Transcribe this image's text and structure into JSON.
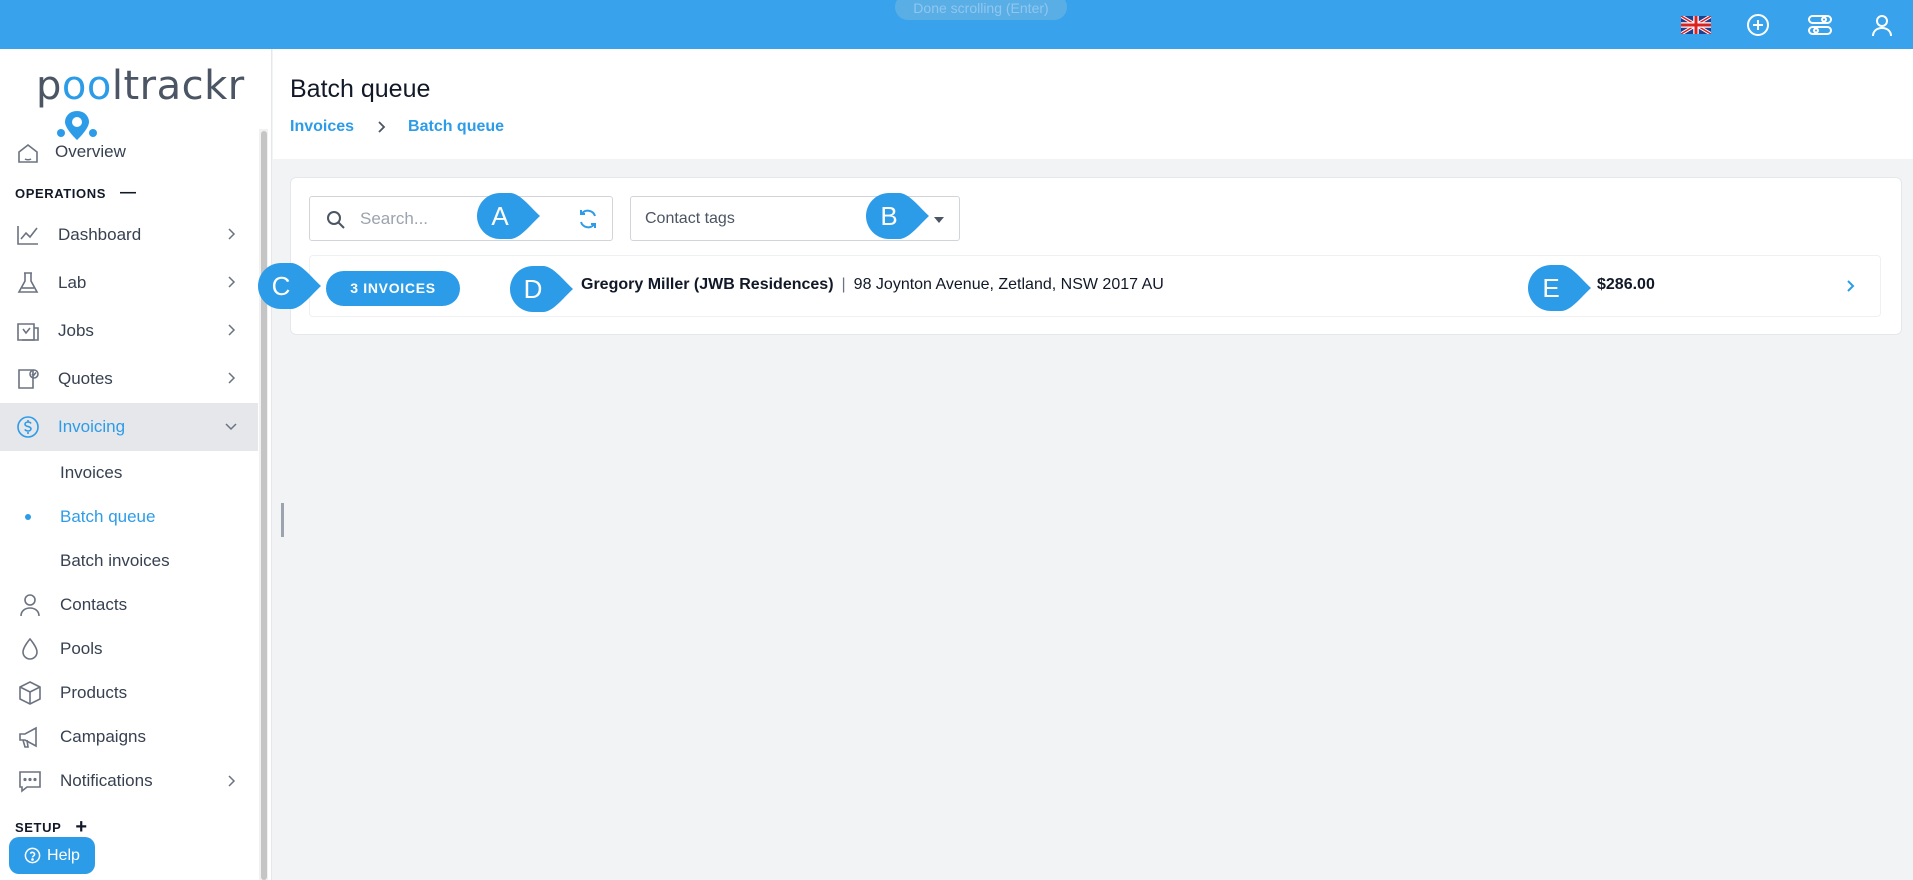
{
  "topbar": {
    "done_scrolling": "Done scrolling (Enter)",
    "icons": [
      "uk-flag-icon",
      "add-circle-icon",
      "settings-toggle-icon",
      "user-icon"
    ],
    "accent": "#38a3ec"
  },
  "sidebar": {
    "logo": {
      "pre": "p",
      "o": "oo",
      "post": "ltrackr"
    },
    "overview": "Overview",
    "operations_label": "OPERATIONS",
    "operations_toggle": "—",
    "items": [
      {
        "label": "Dashboard",
        "icon": "chart-line-icon"
      },
      {
        "label": "Lab",
        "icon": "beaker-icon"
      },
      {
        "label": "Jobs",
        "icon": "jobs-icon"
      },
      {
        "label": "Quotes",
        "icon": "quote-icon"
      },
      {
        "label": "Invoicing",
        "icon": "dollar-circle-icon"
      }
    ],
    "invoicing_sub": [
      "Invoices",
      "Batch queue",
      "Batch invoices"
    ],
    "items_lower": [
      {
        "label": "Contacts",
        "icon": "person-icon"
      },
      {
        "label": "Pools",
        "icon": "droplet-icon"
      },
      {
        "label": "Products",
        "icon": "box-icon"
      },
      {
        "label": "Campaigns",
        "icon": "megaphone-icon"
      },
      {
        "label": "Notifications",
        "icon": "chat-icon"
      }
    ],
    "setup_label": "SETUP",
    "setup_toggle": "+",
    "help": "Help"
  },
  "header": {
    "title": "Batch queue",
    "breadcrumb": [
      "Invoices",
      "Batch queue"
    ]
  },
  "filters": {
    "search_placeholder": "Search...",
    "search_value": "",
    "contact_tags": "Contact tags"
  },
  "row": {
    "badge": "3 INVOICES",
    "contact_name": "Gregory Miller (JWB Residences)",
    "separator": "|",
    "address": "98 Joynton Avenue, Zetland, NSW 2017 AU",
    "amount": "$286.00"
  },
  "markers": [
    "A",
    "B",
    "C",
    "D",
    "E"
  ],
  "colors": {
    "brand": "#2d9ce8",
    "active_bg": "#e5e7eb"
  }
}
